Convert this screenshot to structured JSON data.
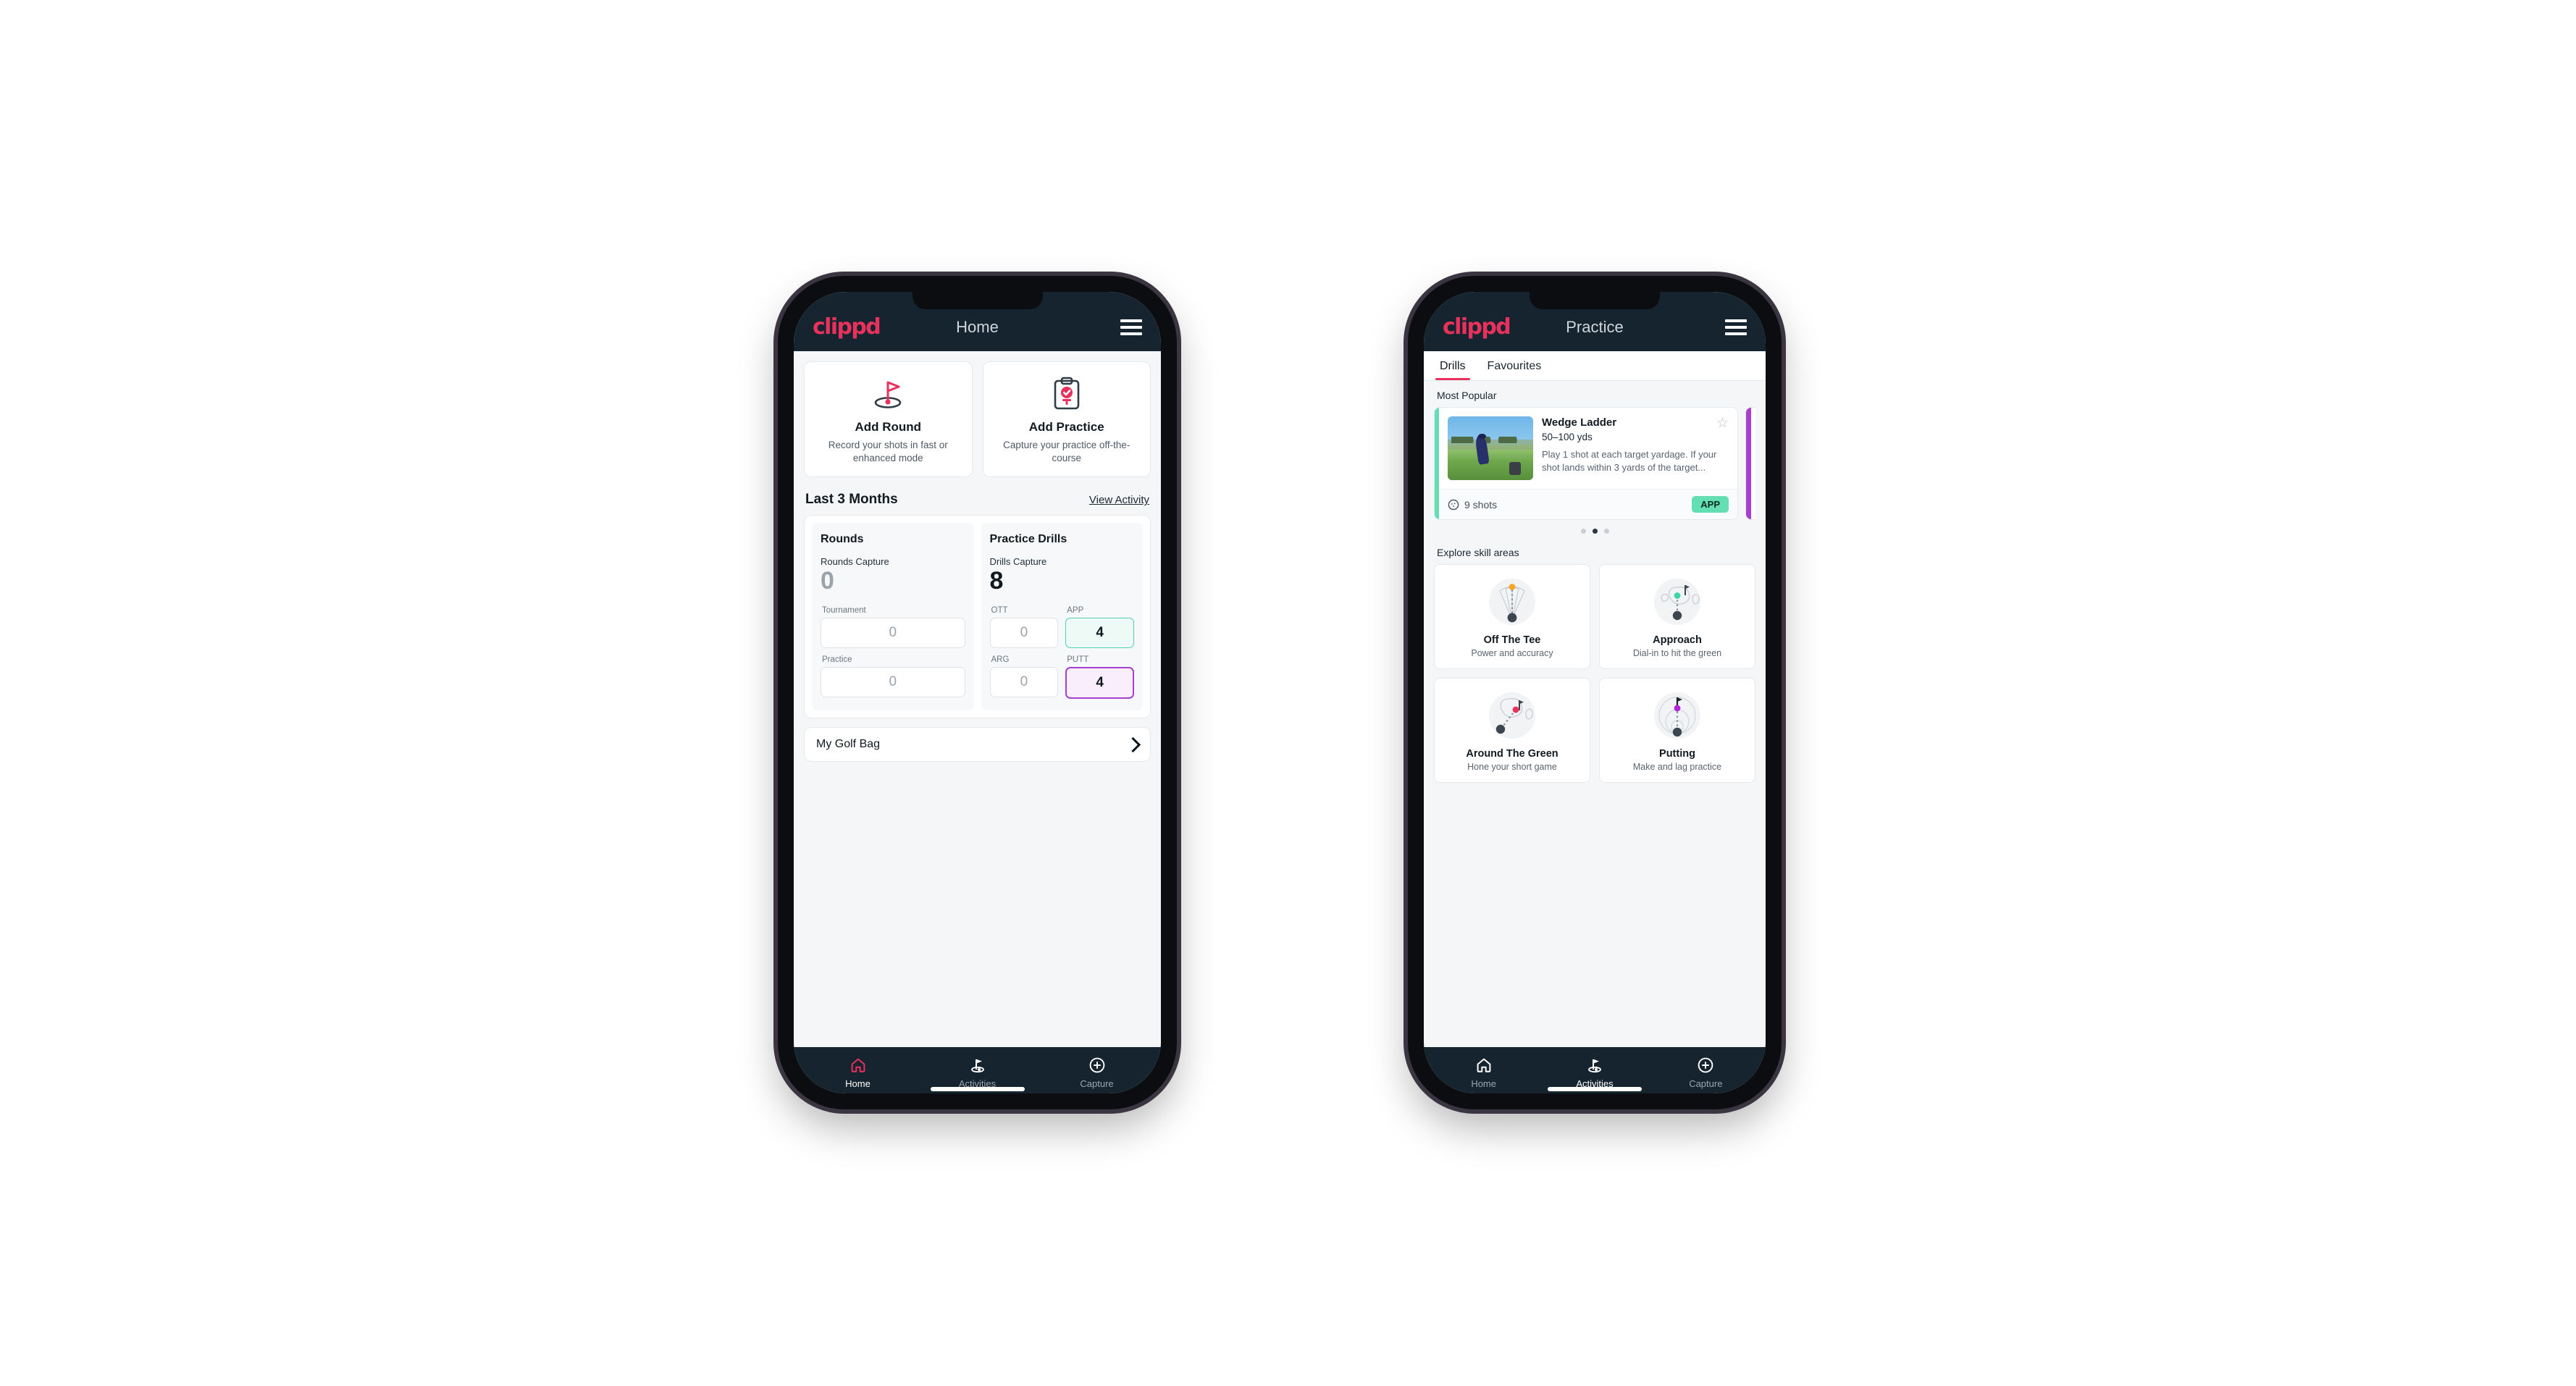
{
  "brand": {
    "logo_text": "clippd",
    "accent": "#e8315c",
    "header_bg": "#16242f"
  },
  "phone_home": {
    "appbar": {
      "title": "Home",
      "menu_icon": "hamburger-menu-icon"
    },
    "quick_actions": [
      {
        "icon": "golf-flag-hole-icon",
        "title": "Add Round",
        "subtitle": "Record your shots in fast or enhanced mode"
      },
      {
        "icon": "clipboard-check-icon",
        "title": "Add Practice",
        "subtitle": "Capture your practice off-the-course"
      }
    ],
    "section": {
      "title": "Last 3 Months",
      "link": "View Activity"
    },
    "rounds": {
      "title": "Rounds",
      "capture_label": "Rounds Capture",
      "capture_value": "0",
      "fields": [
        {
          "label": "Tournament",
          "value": "0",
          "style": "plain"
        },
        {
          "label": "Practice",
          "value": "0",
          "style": "plain"
        }
      ]
    },
    "drills": {
      "title": "Practice Drills",
      "capture_label": "Drills Capture",
      "capture_value": "8",
      "fields": [
        {
          "label": "OTT",
          "value": "0",
          "style": "plain"
        },
        {
          "label": "APP",
          "value": "4",
          "style": "teal"
        },
        {
          "label": "ARG",
          "value": "0",
          "style": "plain"
        },
        {
          "label": "PUTT",
          "value": "4",
          "style": "purple"
        }
      ]
    },
    "golf_bag": {
      "label": "My Golf Bag",
      "chevron": "chevron-right-icon"
    },
    "tabbar": [
      {
        "icon": "home-icon",
        "label": "Home",
        "active": true
      },
      {
        "icon": "golf-flag-icon",
        "label": "Activities",
        "active": false
      },
      {
        "icon": "plus-circle-icon",
        "label": "Capture",
        "active": false
      }
    ]
  },
  "phone_practice": {
    "appbar": {
      "title": "Practice",
      "menu_icon": "hamburger-menu-icon"
    },
    "tabs": [
      {
        "label": "Drills",
        "active": true
      },
      {
        "label": "Favourites",
        "active": false
      }
    ],
    "most_popular_label": "Most Popular",
    "drill_card": {
      "accent_color": "#64dfb4",
      "title": "Wedge Ladder",
      "yardage": "50–100 yds",
      "description": "Play 1 shot at each target yardage. If your shot lands within 3 yards of the target...",
      "shots": "9 shots",
      "shots_icon": "golf-ball-icon",
      "badge": "APP",
      "badge_color": "#64dfb4",
      "favourite_icon": "star-outline-icon",
      "thumbnail": "golfer-wedge-shot-photo"
    },
    "next_card_accent": "#a93fd0",
    "carousel_dots": [
      false,
      true,
      false
    ],
    "skills_label": "Explore skill areas",
    "skills": [
      {
        "icon": "tee-shot-fan-icon",
        "dot_color": "#f5a623",
        "title": "Off The Tee",
        "subtitle": "Power and accuracy"
      },
      {
        "icon": "approach-green-icon",
        "dot_color": "#3fd4a6",
        "title": "Approach",
        "subtitle": "Dial-in to hit the green"
      },
      {
        "icon": "around-green-icon",
        "dot_color": "#e8315c",
        "title": "Around The Green",
        "subtitle": "Hone your short game"
      },
      {
        "icon": "putting-rings-icon",
        "dot_color": "#b324d6",
        "title": "Putting",
        "subtitle": "Make and lag practice"
      }
    ],
    "tabbar": [
      {
        "icon": "home-icon",
        "label": "Home",
        "active": false
      },
      {
        "icon": "golf-flag-icon",
        "label": "Activities",
        "active": true
      },
      {
        "icon": "plus-circle-icon",
        "label": "Capture",
        "active": false
      }
    ]
  }
}
